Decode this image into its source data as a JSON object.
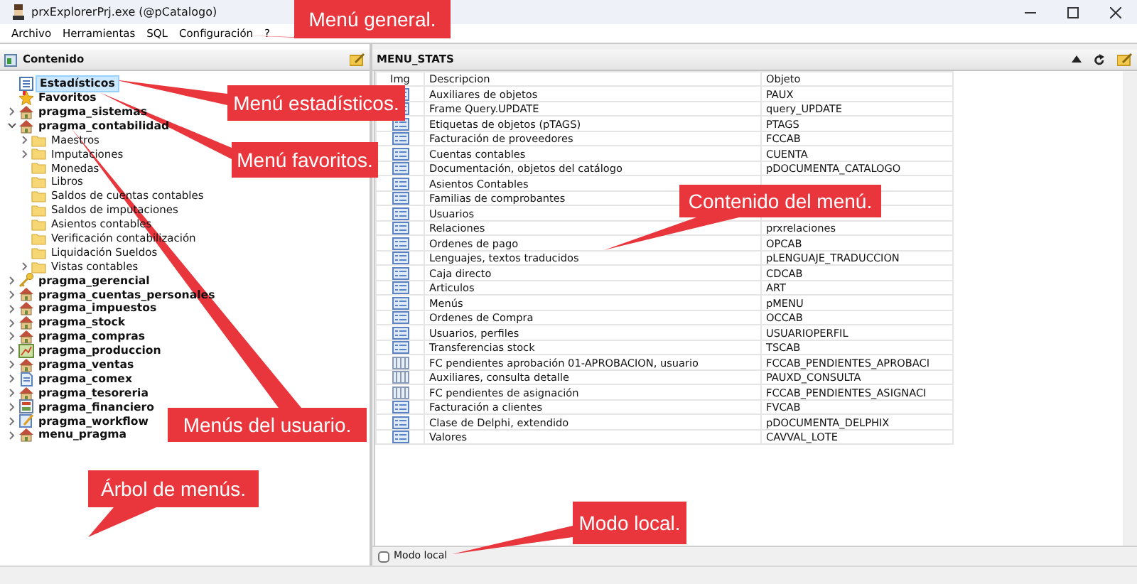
{
  "window": {
    "title": "prxExplorerPrj.exe (@pCatalogo)"
  },
  "menu_bar": [
    "Archivo",
    "Herramientas",
    "SQL",
    "Configuración",
    "?"
  ],
  "left_panel": {
    "title": "Contenido",
    "tree": [
      {
        "label": "Estadísticos",
        "kind": "stats",
        "selected": true
      },
      {
        "label": "Favoritos",
        "kind": "favorites",
        "selected": false
      },
      {
        "label": "pragma_sistemas",
        "kind": "house",
        "selected": false,
        "expanded": false
      },
      {
        "label": "pragma_contabilidad",
        "kind": "house",
        "selected": false,
        "expanded": true,
        "children": [
          {
            "label": "Maestros",
            "kind": "folder",
            "selected": false,
            "expanded": false
          },
          {
            "label": "Imputaciones",
            "kind": "folder",
            "selected": false,
            "expanded": false
          },
          {
            "label": "Monedas",
            "kind": "folder",
            "selected": false
          },
          {
            "label": "Libros",
            "kind": "folder",
            "selected": false
          },
          {
            "label": "Saldos de cuentas contables",
            "kind": "folder",
            "selected": false
          },
          {
            "label": "Saldos de imputaciones",
            "kind": "folder",
            "selected": false
          },
          {
            "label": "Asientos contables",
            "kind": "folder",
            "selected": false
          },
          {
            "label": "Verificación contabilización",
            "kind": "folder",
            "selected": false
          },
          {
            "label": "Liquidación Sueldos",
            "kind": "folder",
            "selected": false
          },
          {
            "label": "Vistas contables",
            "kind": "folder",
            "selected": false,
            "expanded": false
          }
        ]
      },
      {
        "label": "pragma_gerencial",
        "kind": "key",
        "selected": false,
        "expanded": false
      },
      {
        "label": "pragma_cuentas_personales",
        "kind": "house",
        "selected": false,
        "expanded": false
      },
      {
        "label": "pragma_impuestos",
        "kind": "house",
        "selected": false,
        "expanded": false
      },
      {
        "label": "pragma_stock",
        "kind": "house",
        "selected": false,
        "expanded": false
      },
      {
        "label": "pragma_compras",
        "kind": "house",
        "selected": false,
        "expanded": false
      },
      {
        "label": "pragma_produccion",
        "kind": "chart",
        "selected": false,
        "expanded": false
      },
      {
        "label": "pragma_ventas",
        "kind": "house",
        "selected": false,
        "expanded": false
      },
      {
        "label": "pragma_comex",
        "kind": "document",
        "selected": false,
        "expanded": false
      },
      {
        "label": "pragma_tesoreria",
        "kind": "house",
        "selected": false,
        "expanded": false
      },
      {
        "label": "pragma_financiero",
        "kind": "calc",
        "selected": false,
        "expanded": false
      },
      {
        "label": "pragma_workflow",
        "kind": "pencil",
        "selected": false,
        "expanded": false
      },
      {
        "label": "menu_pragma",
        "kind": "house",
        "selected": false,
        "expanded": false
      }
    ]
  },
  "right_panel": {
    "title": "MENU_STATS",
    "columns": [
      "Img",
      "Descripcion",
      "Objeto"
    ],
    "rows": [
      {
        "kind": "form",
        "descripcion": "Auxiliares de objetos",
        "objeto": "PAUX"
      },
      {
        "kind": "form",
        "descripcion": "Frame Query.UPDATE",
        "objeto": "query_UPDATE"
      },
      {
        "kind": "form",
        "descripcion": "Etiquetas de objetos (pTAGS)",
        "objeto": "PTAGS"
      },
      {
        "kind": "form",
        "descripcion": "Facturación de proveedores",
        "objeto": "FCCAB"
      },
      {
        "kind": "form",
        "descripcion": "Cuentas contables",
        "objeto": "CUENTA"
      },
      {
        "kind": "form",
        "descripcion": "Documentación, objetos del catálogo",
        "objeto": "pDOCUMENTA_CATALOGO"
      },
      {
        "kind": "form",
        "descripcion": "Asientos Contables"
      },
      {
        "kind": "form",
        "descripcion": "Familias de comprobantes"
      },
      {
        "kind": "form",
        "descripcion": "Usuarios"
      },
      {
        "kind": "form",
        "descripcion": "Relaciones",
        "objeto": "prxrelaciones"
      },
      {
        "kind": "form",
        "descripcion": "Ordenes de pago",
        "objeto": "OPCAB"
      },
      {
        "kind": "form",
        "descripcion": "Lenguajes, textos traducidos",
        "objeto": "pLENGUAJE_TRADUCCION"
      },
      {
        "kind": "form",
        "descripcion": "Caja directo",
        "objeto": "CDCAB"
      },
      {
        "kind": "form",
        "descripcion": "Articulos",
        "objeto": "ART"
      },
      {
        "kind": "form",
        "descripcion": "Menús",
        "objeto": "pMENU"
      },
      {
        "kind": "form",
        "descripcion": "Ordenes de Compra",
        "objeto": "OCCAB"
      },
      {
        "kind": "form",
        "descripcion": "Usuarios, perfiles",
        "objeto": "USUARIOPERFIL"
      },
      {
        "kind": "form",
        "descripcion": "Transferencias stock",
        "objeto": "TSCAB"
      },
      {
        "kind": "grid",
        "descripcion": "FC pendientes aprobación 01-APROBACION, usuario",
        "objeto": "FCCAB_PENDIENTES_APROBACI"
      },
      {
        "kind": "grid",
        "descripcion": "Auxiliares, consulta detalle",
        "objeto": "PAUXD_CONSULTA"
      },
      {
        "kind": "grid",
        "descripcion": "FC pendientes de asignación",
        "objeto": "FCCAB_PENDIENTES_ASIGNACI"
      },
      {
        "kind": "form",
        "descripcion": "Facturación a clientes",
        "objeto": "FVCAB"
      },
      {
        "kind": "form",
        "descripcion": "Clase de Delphi, extendido",
        "objeto": "pDOCUMENTA_DELPHIX"
      },
      {
        "kind": "form",
        "descripcion": "Valores",
        "objeto": "CAVVAL_LOTE"
      }
    ],
    "local_mode": {
      "label": "Modo local",
      "checked": false
    }
  },
  "annotations": [
    {
      "text": "Menú general."
    },
    {
      "text": "Menú estadísticos."
    },
    {
      "text": "Menú favoritos."
    },
    {
      "text": "Contenido del menú."
    },
    {
      "text": "Menús del usuario."
    },
    {
      "text": "Árbol de menús."
    },
    {
      "text": "Modo local."
    }
  ]
}
